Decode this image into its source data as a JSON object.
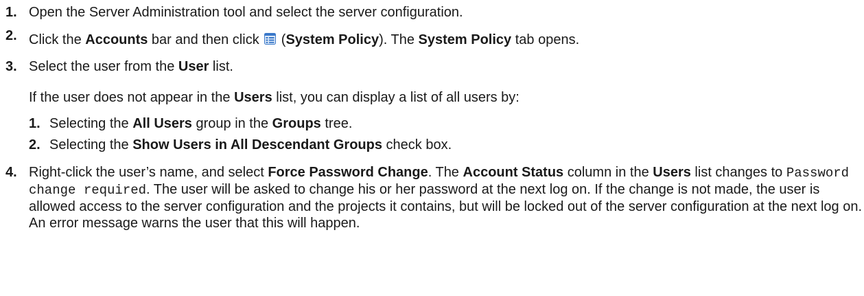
{
  "steps": [
    {
      "number": "1.",
      "text": "Open the Server Administration tool and select the server configuration."
    },
    {
      "number": "2.",
      "t1": "Click the ",
      "b1": "Accounts",
      "t2": " bar and then click ",
      "icon": "system-policy-icon",
      "t3": " (",
      "b2": "System Policy",
      "t4": "). The ",
      "b3": "System Policy",
      "t5": " tab opens."
    },
    {
      "number": "3.",
      "t1": "Select the user from the ",
      "b1": "User",
      "t2": " list."
    },
    {
      "number": "4.",
      "t1": "Right-click the user’s name, and select ",
      "b1": "Force Password Change",
      "t2": ". The ",
      "b2": "Account Status",
      "t3": " column in the ",
      "b3": "Users",
      "t4": " list changes to ",
      "code": "Password change required",
      "t5": ". The user will be asked to change his or her password at the next log on. If the change is not made, the user is allowed access to the server configuration and the projects it contains, but will be locked out of the server configuration at the next log on. An error message warns the user that this will happen."
    }
  ],
  "note": {
    "t1": "If the user does not appear in the ",
    "b1": "Users",
    "t2": " list, you can display a list of all users by:"
  },
  "substeps": [
    {
      "number": "1.",
      "t1": "Selecting the ",
      "b1": "All Users",
      "t2": " group in the ",
      "b2": "Groups",
      "t3": " tree."
    },
    {
      "number": "2.",
      "t1": "Selecting the ",
      "b1": "Show Users in All Descendant Groups",
      "t2": " check box."
    }
  ],
  "colors": {
    "text": "#1a1a1a",
    "icon_blue": "#3a78c9",
    "icon_fill": "#dbe8f7"
  }
}
